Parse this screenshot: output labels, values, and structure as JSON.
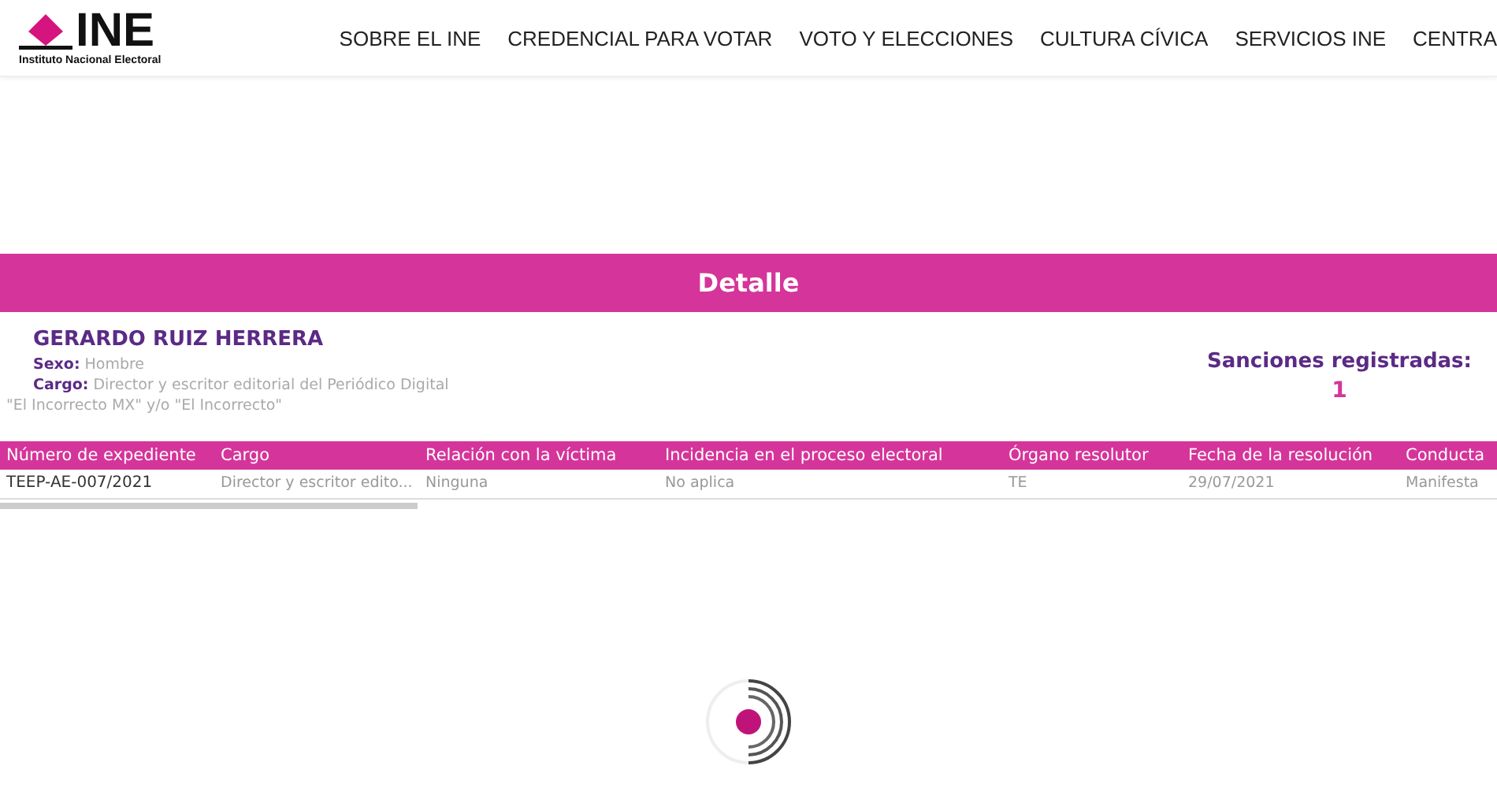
{
  "header": {
    "logo_text": "INE",
    "logo_subtitle": "Instituto Nacional Electoral",
    "nav": [
      "SOBRE EL INE",
      "CREDENCIAL PARA VOTAR",
      "VOTO Y ELECCIONES",
      "CULTURA CÍVICA",
      "SERVICIOS INE",
      "CENTRA"
    ]
  },
  "detail": {
    "title": "Detalle",
    "name": "GERARDO RUIZ HERRERA",
    "fields": [
      {
        "label": "Sexo:",
        "value": "Hombre"
      },
      {
        "label": "Cargo:",
        "value": "Director y escritor editorial del Periódico Digital"
      }
    ],
    "continuation": "\"El Incorrecto MX\" y/o \"El Incorrecto\"",
    "sanctions_label": "Sanciones registradas:",
    "sanctions_count": "1"
  },
  "table": {
    "columns": [
      "Número de expediente",
      "Cargo",
      "Relación con la víctima",
      "Incidencia en el proceso electoral",
      "Órgano resolutor",
      "Fecha de la resolución",
      "Conducta"
    ],
    "rows": [
      [
        "TEEP-AE-007/2021",
        "Director y escritor edito...",
        "Ninguna",
        "No aplica",
        "TE",
        "29/07/2021",
        "Manifesta"
      ]
    ]
  }
}
